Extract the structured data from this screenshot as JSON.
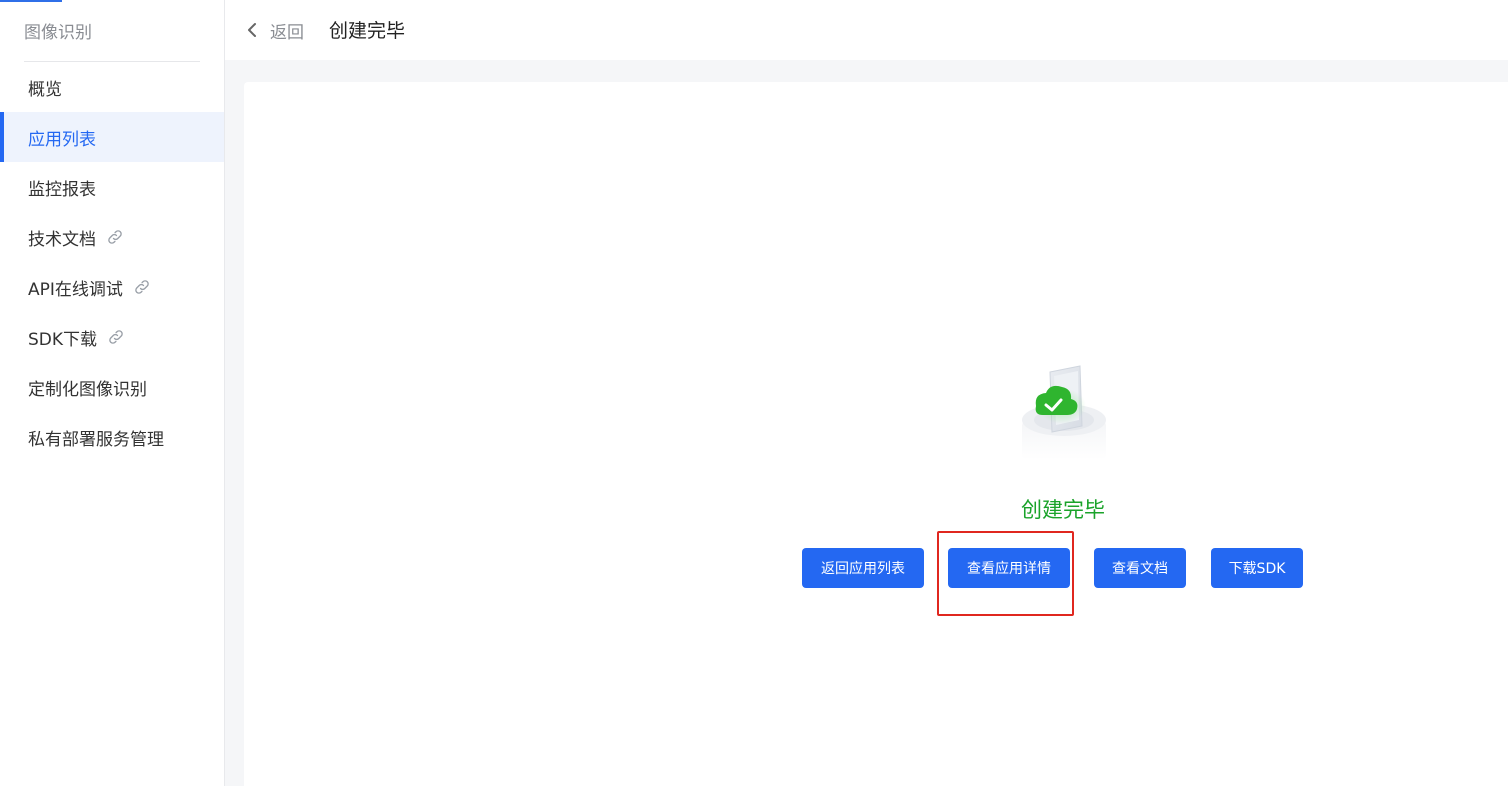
{
  "sidebar": {
    "title": "图像识别",
    "items": [
      {
        "label": "概览",
        "active": false,
        "external": false
      },
      {
        "label": "应用列表",
        "active": true,
        "external": false
      },
      {
        "label": "监控报表",
        "active": false,
        "external": false
      },
      {
        "label": "技术文档",
        "active": false,
        "external": true,
        "icon": "link-icon"
      },
      {
        "label": "API在线调试",
        "active": false,
        "external": true,
        "icon": "link-icon"
      },
      {
        "label": "SDK下载",
        "active": false,
        "external": true,
        "icon": "link-icon"
      },
      {
        "label": "定制化图像识别",
        "active": false,
        "external": false
      },
      {
        "label": "私有部署服务管理",
        "active": false,
        "external": false
      }
    ]
  },
  "header": {
    "back_icon": "chevron-left-icon",
    "back_label": "返回",
    "title": "创建完毕"
  },
  "result": {
    "illustration_icon": "cloud-check-icon",
    "title": "创建完毕",
    "buttons": {
      "back_to_list": "返回应用列表",
      "view_details": "查看应用详情",
      "view_docs": "查看文档",
      "download_sdk": "下载SDK"
    }
  },
  "colors": {
    "primary": "#2468f2",
    "success": "#1aa32a",
    "highlight": "#e0271f",
    "active_bg": "#eef3fd"
  }
}
